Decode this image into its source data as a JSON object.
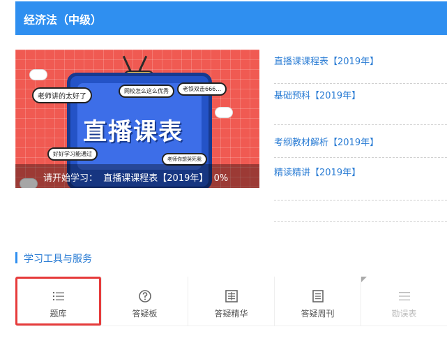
{
  "header": {
    "title": "经济法（中级）"
  },
  "banner": {
    "title_art": "直播课表",
    "bubbles": [
      "老师讲的太好了",
      "网校怎么这么优秀",
      "老铁双击666…",
      "好好学习能通过",
      "老师你想哭死我"
    ],
    "overlay_prefix": "请开始学习：",
    "overlay_course": "直播课课程表【2019年】",
    "overlay_progress": "0%"
  },
  "courses": [
    {
      "label": "直播课课程表【2019年】"
    },
    {
      "label": "基础预科【2019年】"
    },
    {
      "label": "考纲教材解析【2019年】"
    },
    {
      "label": "精读精讲【2019年】"
    }
  ],
  "tools_section": {
    "title": "学习工具与服务"
  },
  "tools": [
    {
      "label": "题库",
      "icon": "list-icon"
    },
    {
      "label": "答疑板",
      "icon": "question-icon"
    },
    {
      "label": "答疑精华",
      "icon": "essence-icon"
    },
    {
      "label": "答疑周刊",
      "icon": "document-icon"
    },
    {
      "label": "勘误表",
      "icon": "menu-icon"
    }
  ],
  "colors": {
    "header_bg": "#2f8ff0",
    "link": "#2a7cd4",
    "selected_border": "#e63b3b"
  }
}
